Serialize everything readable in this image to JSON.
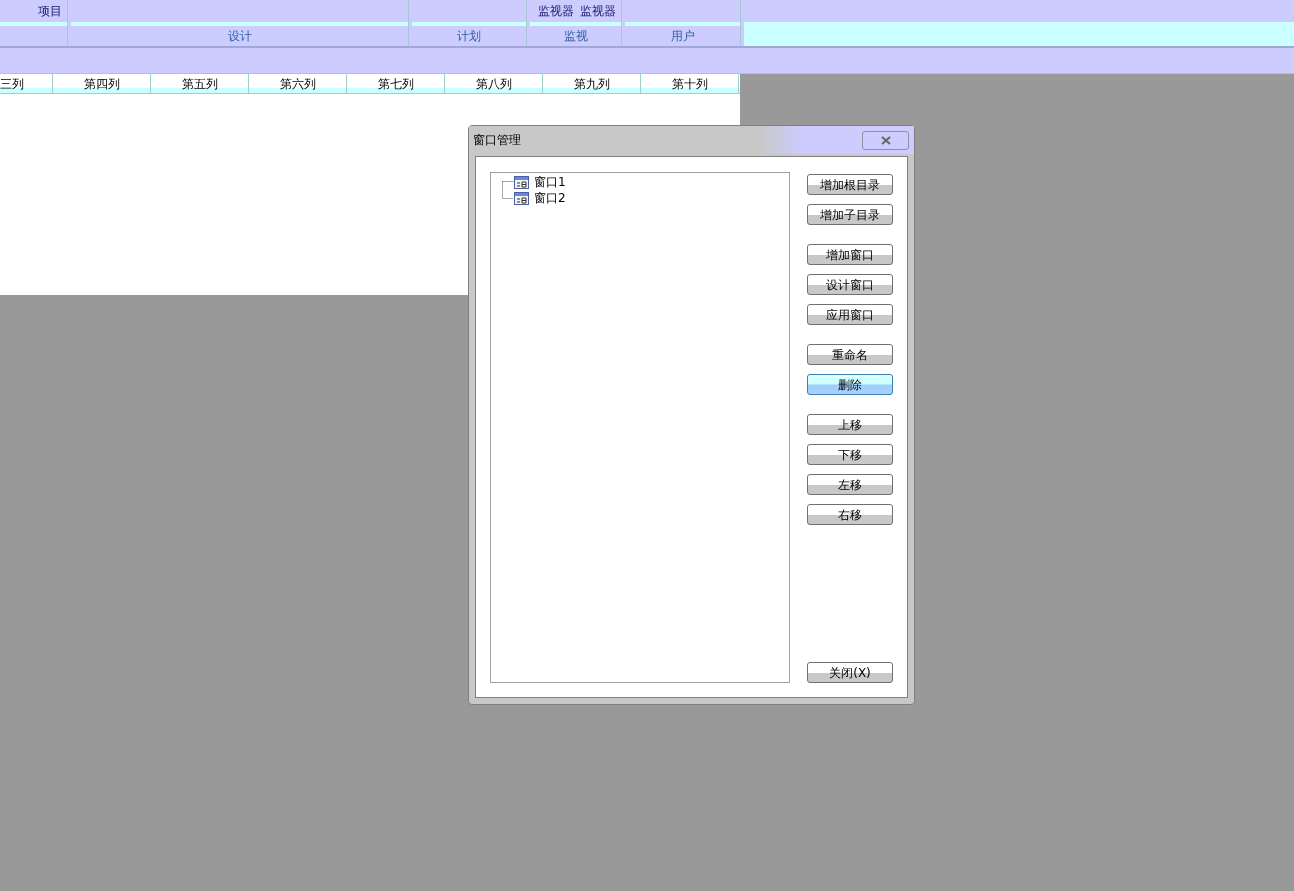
{
  "ribbon": {
    "groups": [
      {
        "items": [
          "项目"
        ]
      },
      {
        "label": "设计"
      },
      {
        "label": "计划"
      },
      {
        "label": "监视",
        "items": [
          "监视器",
          "监视器"
        ]
      },
      {
        "label": "用户"
      }
    ]
  },
  "table": {
    "columns": [
      "三列",
      "第四列",
      "第五列",
      "第六列",
      "第七列",
      "第八列",
      "第九列",
      "第十列"
    ]
  },
  "dialog": {
    "title": "窗口管理",
    "tree": [
      {
        "label": "窗口1"
      },
      {
        "label": "窗口2"
      }
    ],
    "button_groups": [
      [
        {
          "label": "增加根目录",
          "hovered": false
        },
        {
          "label": "增加子目录",
          "hovered": false
        }
      ],
      [
        {
          "label": "增加窗口",
          "hovered": false
        },
        {
          "label": "设计窗口",
          "hovered": false
        },
        {
          "label": "应用窗口",
          "hovered": false
        }
      ],
      [
        {
          "label": "重命名",
          "hovered": false
        },
        {
          "label": "删除",
          "hovered": true
        }
      ],
      [
        {
          "label": "上移",
          "hovered": false
        },
        {
          "label": "下移",
          "hovered": false
        },
        {
          "label": "左移",
          "hovered": false
        },
        {
          "label": "右移",
          "hovered": false
        }
      ]
    ],
    "close_button": {
      "label": "关闭(X)",
      "hovered": false
    }
  }
}
